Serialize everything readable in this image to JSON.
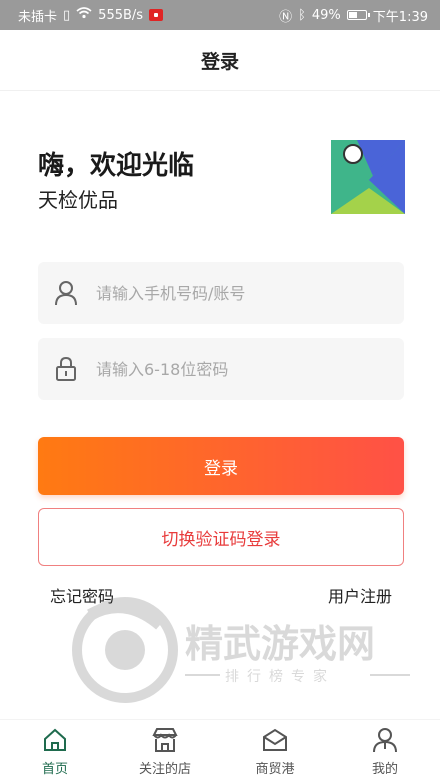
{
  "status_bar": {
    "carrier": "未插卡",
    "net_speed": "555B/s",
    "battery": "49%",
    "time": "下午1:39"
  },
  "header": {
    "title": "登录"
  },
  "welcome": {
    "title": "嗨，欢迎光临",
    "subtitle": "天检优品"
  },
  "form": {
    "account_placeholder": "请输入手机号码/账号",
    "password_placeholder": "请输入6-18位密码",
    "login_label": "登录",
    "switch_label": "切换验证码登录",
    "forgot_label": "忘记密码",
    "register_label": "用户注册"
  },
  "watermark": {
    "brand": "精武游戏网",
    "tagline": "排行榜专家"
  },
  "tabbar": {
    "items": [
      {
        "label": "首页",
        "icon": "home-icon",
        "active": true
      },
      {
        "label": "关注的店",
        "icon": "store-icon",
        "active": false
      },
      {
        "label": "商贸港",
        "icon": "mailbox-icon",
        "active": false
      },
      {
        "label": "我的",
        "icon": "user-icon",
        "active": false
      }
    ]
  },
  "colors": {
    "primary_gradient_start": "#ff7a12",
    "primary_gradient_end": "#ff5146",
    "switch_border": "#f08080",
    "switch_text": "#e83b3b",
    "active_tab": "#1f6b4e",
    "status_bar_bg": "#9a9a9a"
  }
}
